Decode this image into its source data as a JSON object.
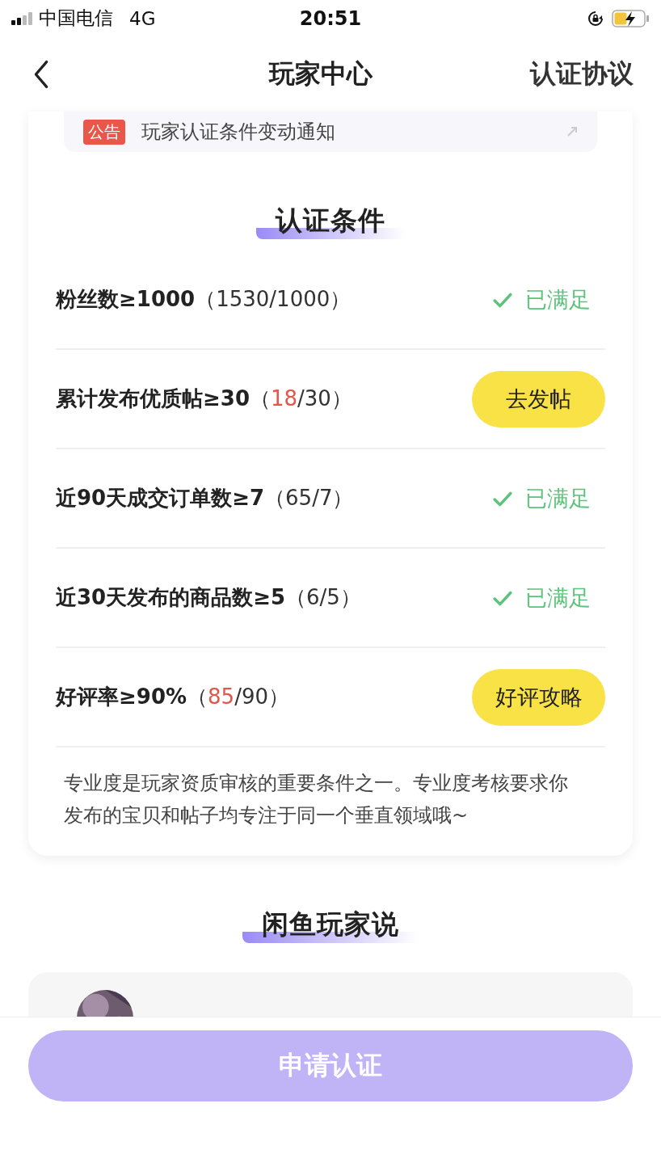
{
  "status_bar": {
    "carrier": "中国电信",
    "network": "4G",
    "time": "20:51"
  },
  "nav": {
    "title": "玩家中心",
    "action": "认证协议"
  },
  "notice": {
    "tag": "公告",
    "text": "玩家认证条件变动通知"
  },
  "conditions": {
    "title": "认证条件",
    "items": [
      {
        "kind": "met",
        "label": "粉丝数≥1000",
        "progress": {
          "before": "（",
          "current": "1530",
          "after": "/1000）"
        },
        "short": false,
        "status": "已满足"
      },
      {
        "kind": "action",
        "label": "累计发布优质帖≥30",
        "progress": {
          "before": "（",
          "current": "18",
          "after": "/30）"
        },
        "short": true,
        "button": "去发帖"
      },
      {
        "kind": "met",
        "label": "近90天成交订单数≥7",
        "progress": {
          "before": "（",
          "current": "65",
          "after": "/7）"
        },
        "short": false,
        "status": "已满足"
      },
      {
        "kind": "met",
        "label": "近30天发布的商品数≥5",
        "progress": {
          "before": "（",
          "current": "6",
          "after": "/5）"
        },
        "short": false,
        "status": "已满足"
      },
      {
        "kind": "action",
        "label": "好评率≥90%",
        "progress": {
          "before": "（",
          "current": "85",
          "after": "/90）"
        },
        "short": true,
        "button": "好评攻略"
      }
    ],
    "note": "专业度是玩家资质审核的重要条件之一。专业度考核要求你发布的宝贝和帖子均专注于同一个垂直领域哦~"
  },
  "reviews": {
    "title": "闲鱼玩家说"
  },
  "apply_button": {
    "label": "申请认证",
    "disabled": true
  }
}
